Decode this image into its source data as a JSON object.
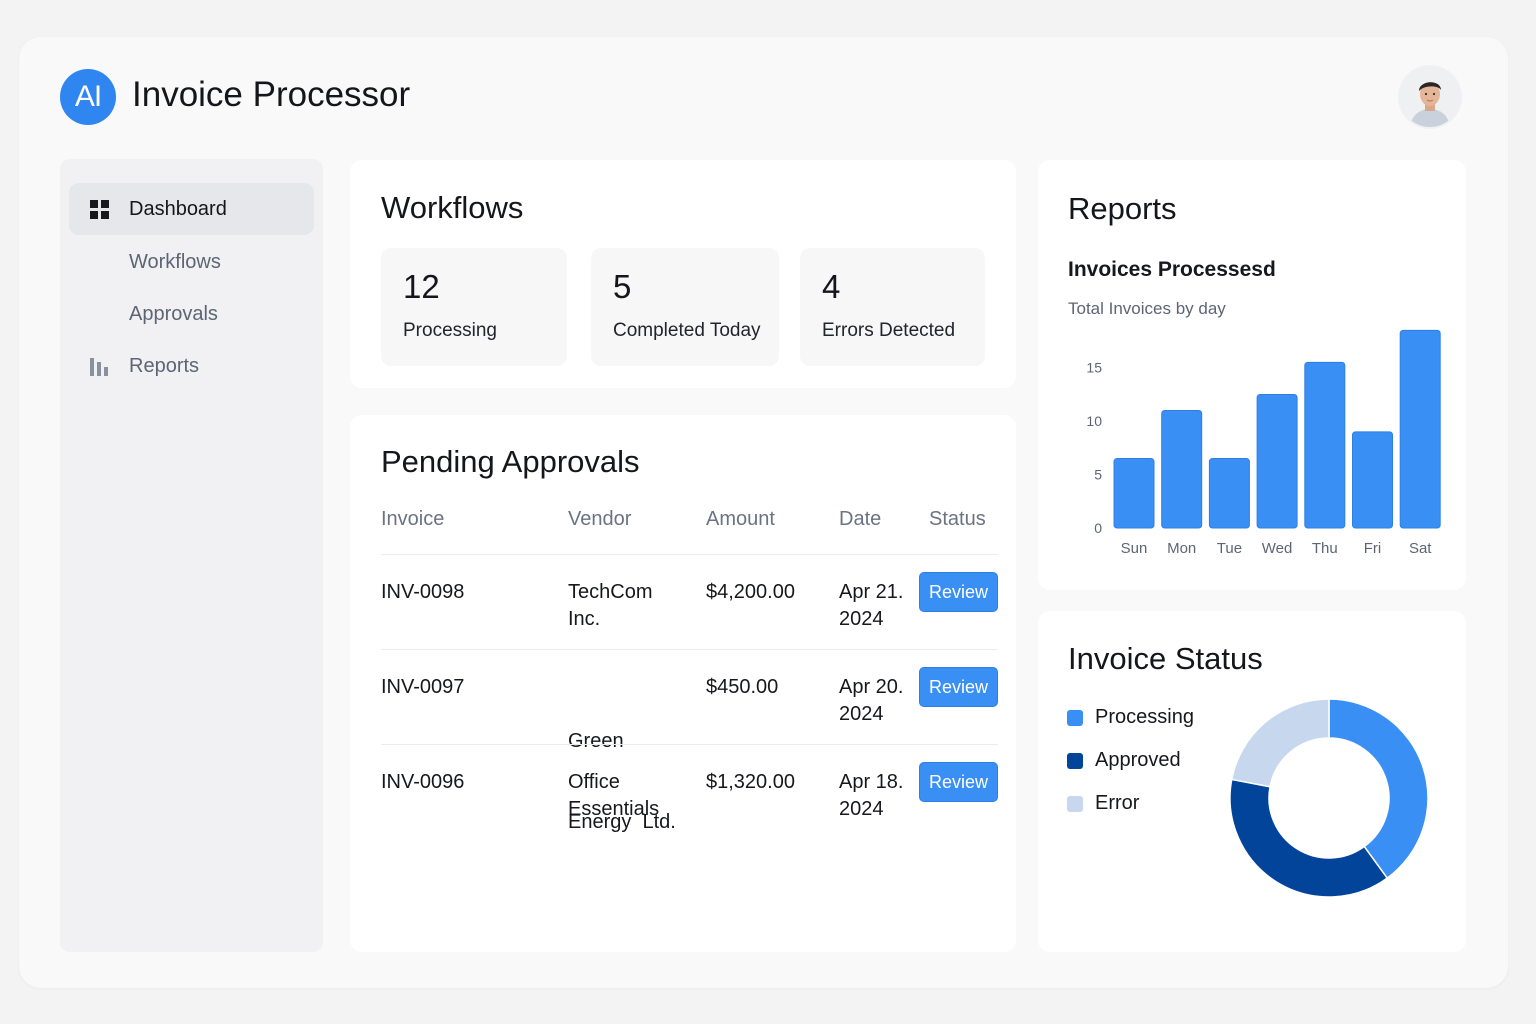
{
  "header": {
    "logo_text": "AI",
    "title": "Invoice Processor",
    "avatar_icon": "user-avatar"
  },
  "sidebar": {
    "items": [
      {
        "label": "Dashboard",
        "icon": "grid-icon"
      },
      {
        "label": "Workflows"
      },
      {
        "label": "Approvals"
      },
      {
        "label": "Reports",
        "icon": "bar-chart-icon"
      }
    ]
  },
  "workflows": {
    "title": "Workflows",
    "stats": [
      {
        "value": "12",
        "label": "Processing"
      },
      {
        "value": "5",
        "label": "Completed Today"
      },
      {
        "value": "4",
        "label": "Errors Detected"
      }
    ]
  },
  "approvals": {
    "title": "Pending Approvals",
    "columns": [
      "Invoice",
      "Vendor",
      "Amount",
      "Date",
      "Status"
    ],
    "rows": [
      {
        "invoice": "INV-0098",
        "vendor_line1": "TechCom",
        "vendor_line2": "Inc.",
        "amount": "$4,200.00",
        "date_line1": "Apr 21.",
        "date_line2": "2024",
        "action": "Review"
      },
      {
        "invoice": "INV-0097",
        "vendor_line1": "Green",
        "vendor_line2": "Energy  Ltd.",
        "amount": "$450.00",
        "date_line1": "Apr 20.",
        "date_line2": "2024",
        "action": "Review"
      },
      {
        "invoice": "INV-0096",
        "vendor_line1": "Office",
        "vendor_line2": "Essentials",
        "amount": "$1,320.00",
        "date_line1": "Apr 18.",
        "date_line2": "2024",
        "action": "Review"
      }
    ]
  },
  "reports": {
    "title": "Reports",
    "chart_title": "Invoices Processesd",
    "chart_subtitle": "Total Invoices by day"
  },
  "invoice_status": {
    "title": "Invoice Status"
  },
  "colors": {
    "accent": "#3a8ff5",
    "bar": "#3a8ff5",
    "processing": "#3a8ff5",
    "approved": "#024499",
    "error": "#c6d7ee"
  },
  "chart_data": [
    {
      "type": "bar",
      "title": "Invoices Processesd",
      "subtitle": "Total Invoices by day",
      "categories": [
        "Sun",
        "Mon",
        "Tue",
        "Wed",
        "Thu",
        "Fri",
        "Sat"
      ],
      "values": [
        6.5,
        11,
        6.5,
        12.5,
        15.5,
        9,
        18.5
      ],
      "yticks": [
        0,
        5,
        10,
        15
      ],
      "ylim": [
        0,
        19
      ],
      "grid": false
    },
    {
      "type": "pie",
      "title": "Invoice Status",
      "categories": [
        "Processing",
        "Approved",
        "Error"
      ],
      "values": [
        40,
        38,
        22
      ],
      "donut": true,
      "legend": "left"
    }
  ]
}
